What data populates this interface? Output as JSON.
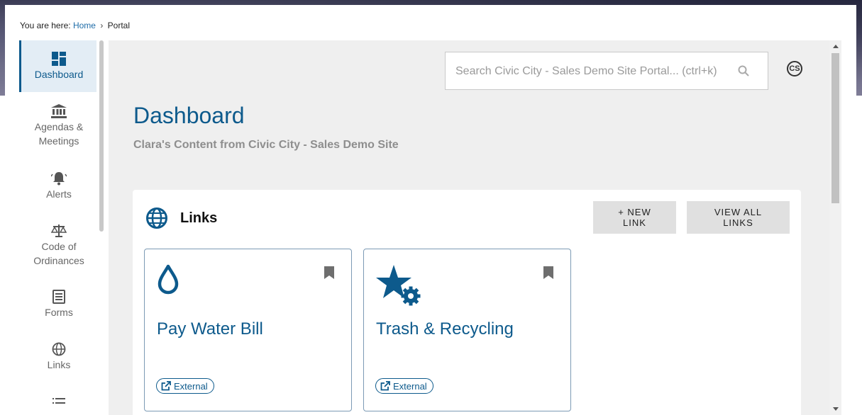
{
  "breadcrumb": {
    "prefix": "You are here:",
    "home": "Home",
    "separator": "›",
    "current": "Portal"
  },
  "sidebar": {
    "items": [
      {
        "label": "Dashboard",
        "icon": "dashboard-icon",
        "active": true
      },
      {
        "label": "Agendas & Meetings",
        "icon": "bank-icon"
      },
      {
        "label": "Alerts",
        "icon": "bell-icon"
      },
      {
        "label": "Code of Ordinances",
        "icon": "scale-icon"
      },
      {
        "label": "Forms",
        "icon": "form-icon"
      },
      {
        "label": "Links",
        "icon": "globe-icon"
      },
      {
        "label": "",
        "icon": "list-icon"
      }
    ]
  },
  "search": {
    "placeholder": "Search Civic City - Sales Demo Site Portal... (ctrl+k)"
  },
  "user": {
    "initials": "CS"
  },
  "page": {
    "title": "Dashboard",
    "subtitle": "Clara's Content from Civic City - Sales Demo Site"
  },
  "links_card": {
    "title": "Links",
    "new_link_label": "+ NEW LINK",
    "view_all_label": "VIEW ALL LINKS",
    "tiles": [
      {
        "title": "Pay Water Bill",
        "icon": "water-drop-icon",
        "badge": "External"
      },
      {
        "title": "Trash & Recycling",
        "icon": "star-gear-icon",
        "badge": "External"
      }
    ]
  },
  "colors": {
    "accent": "#0d5a8c",
    "panel_bg": "#efefef",
    "button_bg": "#e0e0e0"
  }
}
